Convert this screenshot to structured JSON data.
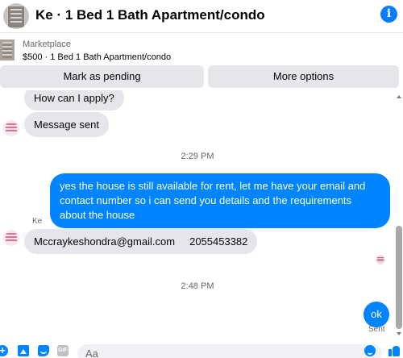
{
  "header": {
    "title": "Ke · 1 Bed 1 Bath Apartment/condo",
    "info_icon": "i"
  },
  "marketplace": {
    "label": "Marketplace",
    "listing": "$500 · 1 Bed 1 Bath Apartment/condo"
  },
  "actions": {
    "pending": "Mark as pending",
    "more": "More options"
  },
  "messages": {
    "in1": "How can I apply?",
    "in2": "Message sent",
    "ts1": "2:29 PM",
    "out1": "yes the house is still available for rent, let me have your email  and contact number so i can send you details and the requirements about the house",
    "sender": "Ke",
    "in3": "Mccraykeshondra@gmail.com     2055453382",
    "ts2": "2:48 PM",
    "out2": "ok",
    "status": "Sent"
  },
  "composer": {
    "placeholder": "Aa",
    "gif_label": "GIF",
    "plus_label": "+"
  },
  "colors": {
    "accent": "#0084ff",
    "bubble_in": "#e4e6eb"
  }
}
